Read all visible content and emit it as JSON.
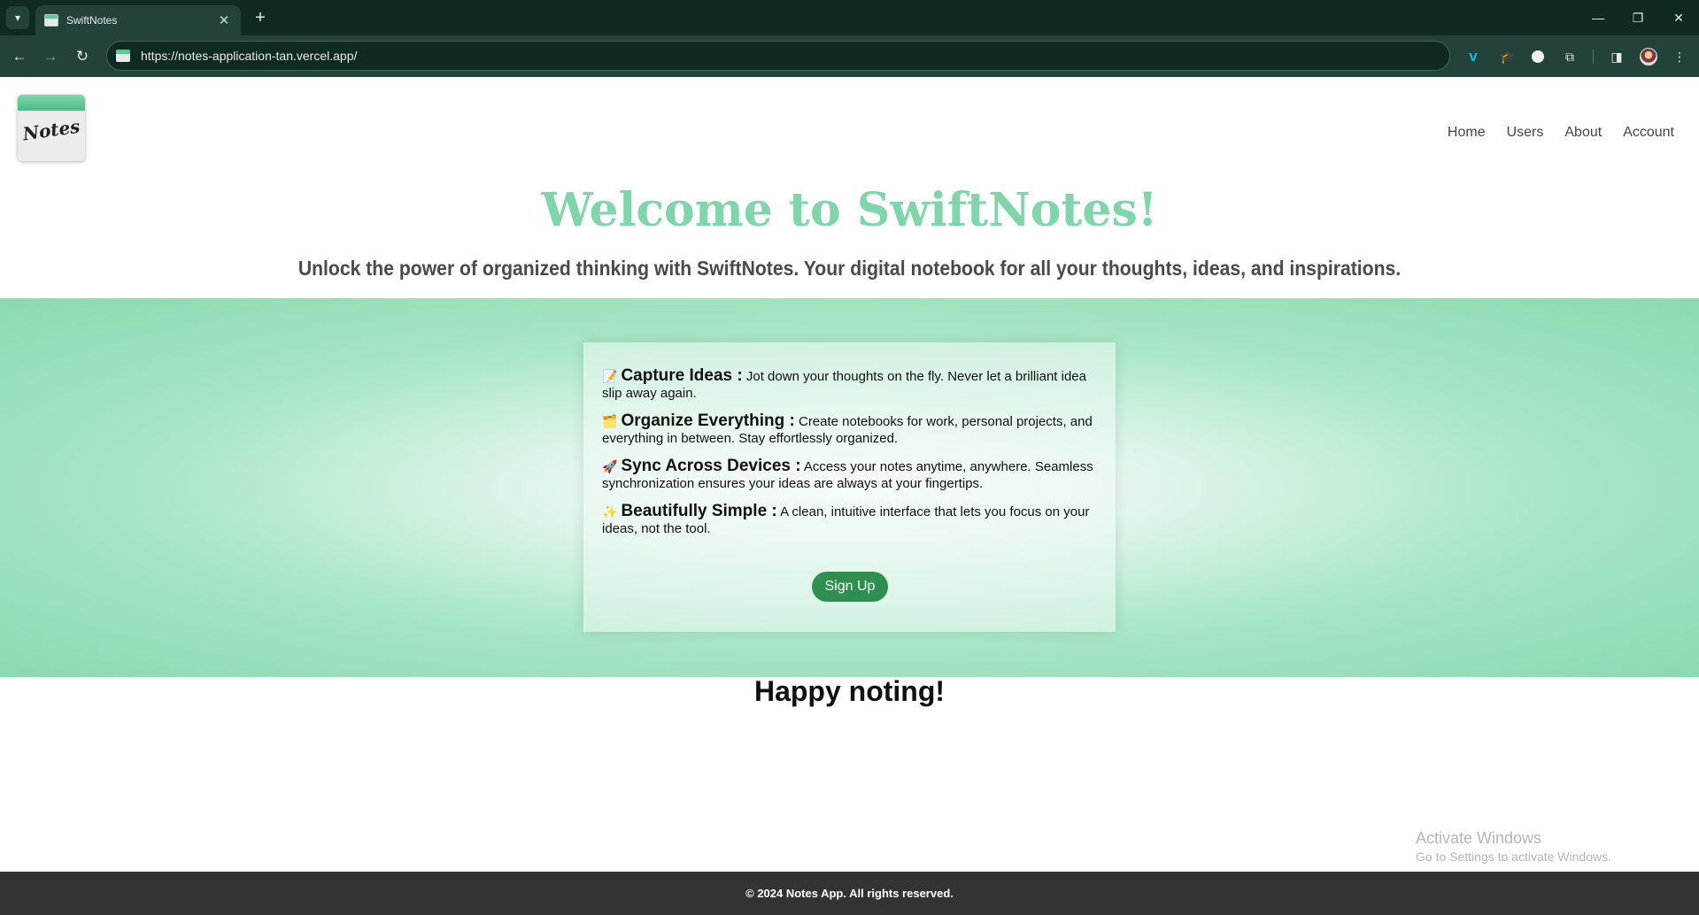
{
  "browser": {
    "tab_title": "SwiftNotes",
    "url": "https://notes-application-tan.vercel.app/",
    "icons": {
      "tab_list": "chevron-down-icon",
      "close_tab": "close-icon",
      "new_tab": "plus-icon",
      "back": "arrow-left-icon",
      "forward": "arrow-right-icon",
      "reload": "reload-icon",
      "extensions": [
        "vimeo-icon",
        "graduation-cap-icon",
        "circle-icon",
        "puzzle-icon"
      ],
      "side_panel": "side-panel-icon",
      "profile": "avatar-icon",
      "menu": "kebab-menu-icon"
    }
  },
  "site": {
    "logo_text": "Notes",
    "nav": [
      "Home",
      "Users",
      "About",
      "Account"
    ],
    "hero": {
      "title": "Welcome to SwiftNotes!",
      "subtitle": "Unlock the power of organized thinking with SwiftNotes. Your digital notebook for all your thoughts, ideas, and inspirations."
    },
    "features": [
      {
        "emoji": "📝",
        "title": "Capture Ideas :",
        "text": " Jot down your thoughts on the fly. Never let a brilliant idea slip away again."
      },
      {
        "emoji": "🗂️",
        "title": "Organize Everything :",
        "text": " Create notebooks for work, personal projects, and everything in between. Stay effortlessly organized."
      },
      {
        "emoji": "🚀",
        "title": "Sync Across Devices :",
        "text": " Access your notes anytime, anywhere. Seamless synchronization ensures your ideas are always at your fingertips."
      },
      {
        "emoji": "✨",
        "title": "Beautifully Simple :",
        "text": " A clean, intuitive interface that lets you focus on your ideas, not the tool."
      }
    ],
    "signup_label": "Sign Up",
    "closing": "Happy noting!",
    "footer": "© 2024 Notes App. All rights reserved."
  },
  "watermark": {
    "line1": "Activate Windows",
    "line2": "Go to Settings to activate Windows."
  },
  "colors": {
    "title_green": "#80d6aa",
    "button_green": "#2e8f4f",
    "band_green": "#8ad9b1",
    "footer_bg": "#333333",
    "chrome_dark": "#0f2a22",
    "chrome_toolbar": "#23433a"
  }
}
